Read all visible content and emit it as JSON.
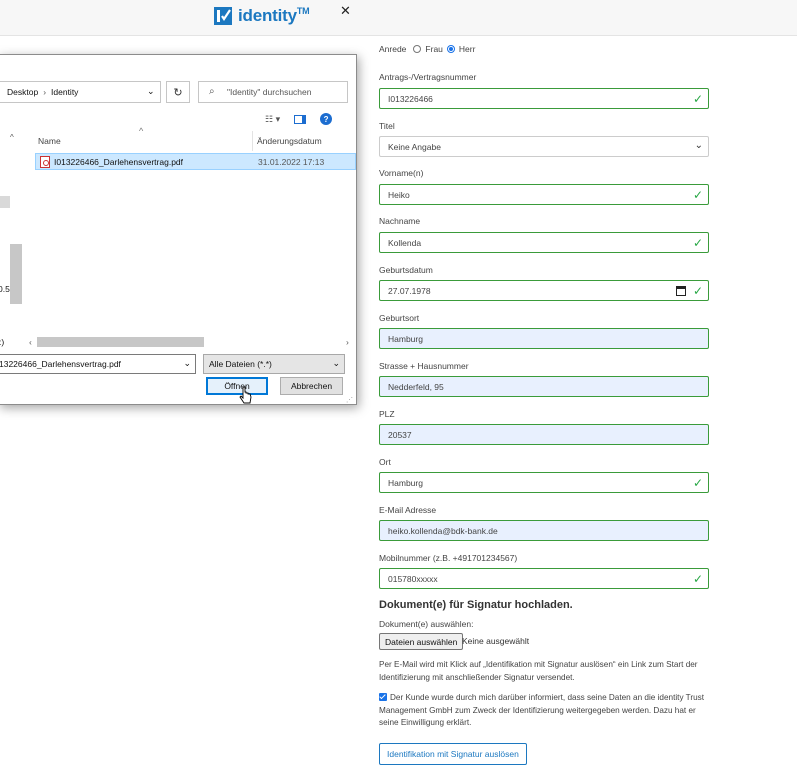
{
  "header": {
    "brand": "identity",
    "tm": "TM",
    "brand_color": "#1c78c0"
  },
  "form": {
    "anrede_label": "Anrede",
    "anrede_frau": "Frau",
    "anrede_herr": "Herr",
    "anrede_selected": "Herr",
    "vertragsnummer_label": "Antrags-/Vertragsnummer",
    "vertragsnummer_value": "I013226466",
    "titel_label": "Titel",
    "titel_value": "Keine Angabe",
    "vorname_label": "Vorname(n)",
    "vorname_value": "Heiko",
    "nachname_label": "Nachname",
    "nachname_value": "Kollenda",
    "geburtsdatum_label": "Geburtsdatum",
    "geburtsdatum_value": "27.07.1978",
    "geburtsort_label": "Geburtsort",
    "geburtsort_value": "Hamburg",
    "strasse_label": "Strasse + Hausnummer",
    "strasse_value": "Nedderfeld, 95",
    "plz_label": "PLZ",
    "plz_value": "20537",
    "ort_label": "Ort",
    "ort_value": "Hamburg",
    "email_label": "E-Mail Adresse",
    "email_value": "heiko.kollenda@bdk-bank.de",
    "mobil_label": "Mobilnummer (z.B. +491701234567)",
    "mobil_value": "015780xxxxx",
    "upload_heading": "Dokument(e) für Signatur hochladen.",
    "upload_label": "Dokument(e) auswählen:",
    "upload_button": "Dateien auswählen",
    "upload_status": "Keine ausgewählt",
    "info_text": "Per E-Mail wird mit Klick auf „Identifikation mit Signatur auslösen“ ein Link zum Start der Identifizierung mit anschließender Signatur versendet.",
    "consent_text": "Der Kunde wurde durch mich darüber informiert, dass seine Daten an die identity Trust Management GmbH zum Zweck der Identifizierung weitergegeben werden. Dazu hat er seine Einwilligung erklärt.",
    "submit_label": "Identifikation mit Signatur auslösen"
  },
  "dialog": {
    "path_1": "Desktop",
    "path_2": "Identity",
    "search_placeholder": "\"Identity\" durchsuchen",
    "col_name": "Name",
    "col_date": "Änderungsdatum",
    "file_name": "I013226466_Darlehensvertrag.pdf",
    "file_date": "31.01.2022 17:13",
    "left_cut_1": "0.5",
    "left_cut_2": ":)",
    "filename_value": "13226466_Darlehensvertrag.pdf",
    "filetype": "Alle Dateien (*.*)",
    "open_label": "Öffnen",
    "cancel_label": "Abbrechen"
  }
}
